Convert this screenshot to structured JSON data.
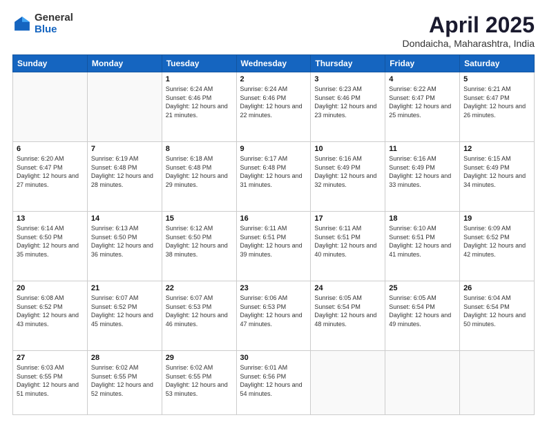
{
  "header": {
    "logo_general": "General",
    "logo_blue": "Blue",
    "title": "April 2025",
    "location": "Dondaicha, Maharashtra, India"
  },
  "calendar": {
    "days_of_week": [
      "Sunday",
      "Monday",
      "Tuesday",
      "Wednesday",
      "Thursday",
      "Friday",
      "Saturday"
    ],
    "weeks": [
      [
        {
          "num": "",
          "info": ""
        },
        {
          "num": "",
          "info": ""
        },
        {
          "num": "1",
          "info": "Sunrise: 6:24 AM\nSunset: 6:46 PM\nDaylight: 12 hours and 21 minutes."
        },
        {
          "num": "2",
          "info": "Sunrise: 6:24 AM\nSunset: 6:46 PM\nDaylight: 12 hours and 22 minutes."
        },
        {
          "num": "3",
          "info": "Sunrise: 6:23 AM\nSunset: 6:46 PM\nDaylight: 12 hours and 23 minutes."
        },
        {
          "num": "4",
          "info": "Sunrise: 6:22 AM\nSunset: 6:47 PM\nDaylight: 12 hours and 25 minutes."
        },
        {
          "num": "5",
          "info": "Sunrise: 6:21 AM\nSunset: 6:47 PM\nDaylight: 12 hours and 26 minutes."
        }
      ],
      [
        {
          "num": "6",
          "info": "Sunrise: 6:20 AM\nSunset: 6:47 PM\nDaylight: 12 hours and 27 minutes."
        },
        {
          "num": "7",
          "info": "Sunrise: 6:19 AM\nSunset: 6:48 PM\nDaylight: 12 hours and 28 minutes."
        },
        {
          "num": "8",
          "info": "Sunrise: 6:18 AM\nSunset: 6:48 PM\nDaylight: 12 hours and 29 minutes."
        },
        {
          "num": "9",
          "info": "Sunrise: 6:17 AM\nSunset: 6:48 PM\nDaylight: 12 hours and 31 minutes."
        },
        {
          "num": "10",
          "info": "Sunrise: 6:16 AM\nSunset: 6:49 PM\nDaylight: 12 hours and 32 minutes."
        },
        {
          "num": "11",
          "info": "Sunrise: 6:16 AM\nSunset: 6:49 PM\nDaylight: 12 hours and 33 minutes."
        },
        {
          "num": "12",
          "info": "Sunrise: 6:15 AM\nSunset: 6:49 PM\nDaylight: 12 hours and 34 minutes."
        }
      ],
      [
        {
          "num": "13",
          "info": "Sunrise: 6:14 AM\nSunset: 6:50 PM\nDaylight: 12 hours and 35 minutes."
        },
        {
          "num": "14",
          "info": "Sunrise: 6:13 AM\nSunset: 6:50 PM\nDaylight: 12 hours and 36 minutes."
        },
        {
          "num": "15",
          "info": "Sunrise: 6:12 AM\nSunset: 6:50 PM\nDaylight: 12 hours and 38 minutes."
        },
        {
          "num": "16",
          "info": "Sunrise: 6:11 AM\nSunset: 6:51 PM\nDaylight: 12 hours and 39 minutes."
        },
        {
          "num": "17",
          "info": "Sunrise: 6:11 AM\nSunset: 6:51 PM\nDaylight: 12 hours and 40 minutes."
        },
        {
          "num": "18",
          "info": "Sunrise: 6:10 AM\nSunset: 6:51 PM\nDaylight: 12 hours and 41 minutes."
        },
        {
          "num": "19",
          "info": "Sunrise: 6:09 AM\nSunset: 6:52 PM\nDaylight: 12 hours and 42 minutes."
        }
      ],
      [
        {
          "num": "20",
          "info": "Sunrise: 6:08 AM\nSunset: 6:52 PM\nDaylight: 12 hours and 43 minutes."
        },
        {
          "num": "21",
          "info": "Sunrise: 6:07 AM\nSunset: 6:52 PM\nDaylight: 12 hours and 45 minutes."
        },
        {
          "num": "22",
          "info": "Sunrise: 6:07 AM\nSunset: 6:53 PM\nDaylight: 12 hours and 46 minutes."
        },
        {
          "num": "23",
          "info": "Sunrise: 6:06 AM\nSunset: 6:53 PM\nDaylight: 12 hours and 47 minutes."
        },
        {
          "num": "24",
          "info": "Sunrise: 6:05 AM\nSunset: 6:54 PM\nDaylight: 12 hours and 48 minutes."
        },
        {
          "num": "25",
          "info": "Sunrise: 6:05 AM\nSunset: 6:54 PM\nDaylight: 12 hours and 49 minutes."
        },
        {
          "num": "26",
          "info": "Sunrise: 6:04 AM\nSunset: 6:54 PM\nDaylight: 12 hours and 50 minutes."
        }
      ],
      [
        {
          "num": "27",
          "info": "Sunrise: 6:03 AM\nSunset: 6:55 PM\nDaylight: 12 hours and 51 minutes."
        },
        {
          "num": "28",
          "info": "Sunrise: 6:02 AM\nSunset: 6:55 PM\nDaylight: 12 hours and 52 minutes."
        },
        {
          "num": "29",
          "info": "Sunrise: 6:02 AM\nSunset: 6:55 PM\nDaylight: 12 hours and 53 minutes."
        },
        {
          "num": "30",
          "info": "Sunrise: 6:01 AM\nSunset: 6:56 PM\nDaylight: 12 hours and 54 minutes."
        },
        {
          "num": "",
          "info": ""
        },
        {
          "num": "",
          "info": ""
        },
        {
          "num": "",
          "info": ""
        }
      ]
    ]
  }
}
